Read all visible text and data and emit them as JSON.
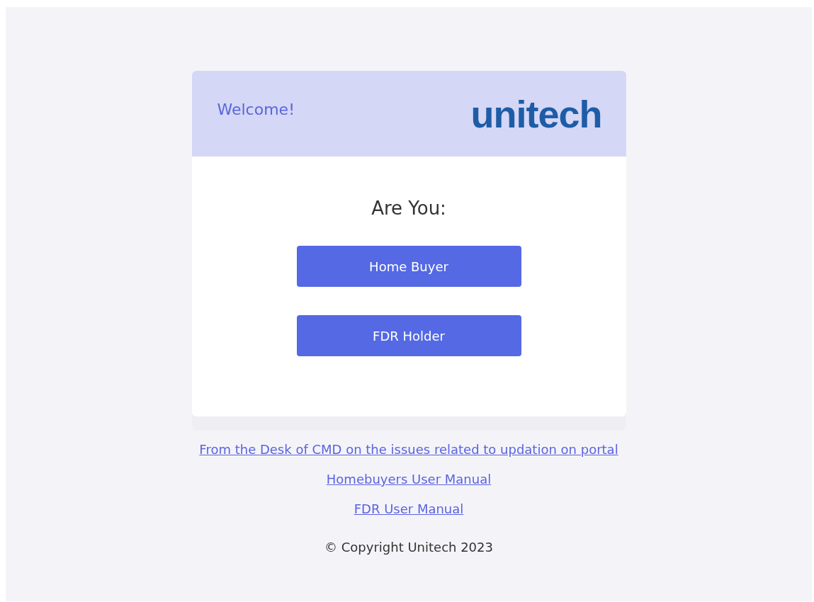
{
  "header": {
    "greeting": "Welcome!",
    "logo": "unitech"
  },
  "prompt": "Are You:",
  "buttons": [
    "Home Buyer",
    "FDR Holder"
  ],
  "links": [
    "From the Desk of CMD on the issues related to updation on portal",
    "Homebuyers User Manual",
    "FDR User Manual"
  ],
  "footer": "© Copyright Unitech 2023"
}
